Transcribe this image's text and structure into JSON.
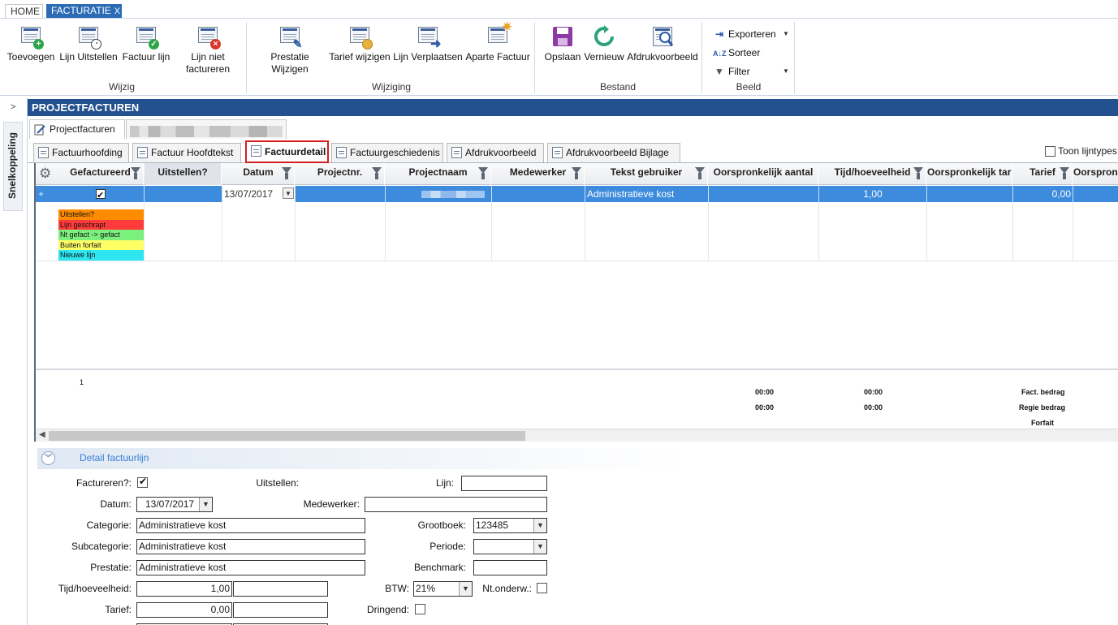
{
  "top_tabs": {
    "home": "HOME",
    "facturatie": "FACTURATIE",
    "close": "X"
  },
  "ribbon": {
    "wijzig": {
      "label": "Wijzig",
      "buttons": [
        "Toevoegen",
        "Lijn Uitstellen",
        "Factuur lijn",
        "Lijn niet",
        "factureren"
      ]
    },
    "wijziging": {
      "label": "Wijziging",
      "buttons": [
        "Prestatie",
        "Wijzigen",
        "Tarief wijzigen",
        "Lijn Verplaatsen",
        "Aparte Factuur"
      ]
    },
    "bestand": {
      "label": "Bestand",
      "buttons": [
        "Opslaan",
        "Vernieuw",
        "Afdrukvoorbeeld"
      ]
    },
    "beeld": {
      "label": "Beeld",
      "buttons": [
        "Exporteren",
        "Sorteer",
        "Filter"
      ]
    }
  },
  "side": {
    "toggle": ">",
    "label": "Snelkoppeling"
  },
  "title": "PROJECTFACTUREN",
  "doc_tabs": {
    "projectfacturen": "Projectfacturen"
  },
  "sub_tabs": [
    "Factuurhoofding",
    "Factuur Hoofdtekst",
    "Factuurdetail",
    "Factuurgeschiedenis",
    "Afdrukvoorbeeld",
    "Afdrukvoorbeeld Bijlage"
  ],
  "toon_lijntypes": "Toon lijntypes",
  "grid": {
    "columns": [
      "Gefactureerd",
      "Uitstellen?",
      "Datum",
      "Projectnr.",
      "Projectnaam",
      "Medewerker",
      "Tekst gebruiker",
      "Oorspronkelijk aantal",
      "Tijd/hoeveelheid",
      "Oorspronkelijk tarief",
      "Tarief",
      "Oorspronk"
    ],
    "row": {
      "datum": "13/07/2017",
      "tekst_gebruiker": "Administratieve kost",
      "tijd": "1,00",
      "tarief": "0,00"
    },
    "legend": [
      {
        "label": "Uitstellen?",
        "color": "#ff8c00"
      },
      {
        "label": "Lijn geschrapt",
        "color": "#ff3b3b"
      },
      {
        "label": "Nt gefact -> gefact",
        "color": "#7cf07c"
      },
      {
        "label": "Buiten forfait",
        "color": "#ffff66"
      },
      {
        "label": "Nieuwe lijn",
        "color": "#2ee6f0"
      }
    ],
    "footer": {
      "count": "1",
      "t1": "00:00",
      "t2": "00:00",
      "t3": "00:00",
      "t4": "00:00",
      "fact_bedrag": "Fact. bedrag",
      "regie_bedrag": "Regie bedrag",
      "forfait": "Forfait"
    }
  },
  "detail": {
    "title": "Detail factuurlijn",
    "labels": {
      "factureren": "Factureren?:",
      "uitstellen": "Uitstellen:",
      "lijn": "Lijn:",
      "datum": "Datum:",
      "medewerker": "Medewerker:",
      "categorie": "Categorie:",
      "grootboek": "Grootboek:",
      "subcategorie": "Subcategorie:",
      "periode": "Periode:",
      "prestatie": "Prestatie:",
      "benchmark": "Benchmark:",
      "tijd": "Tijd/hoeveelheid:",
      "btw": "BTW:",
      "nt_onderw": "Nt.onderw.:",
      "tarief": "Tarief:",
      "dringend": "Dringend:"
    },
    "values": {
      "datum": "13/07/2017",
      "categorie": "Administratieve kost",
      "subcategorie": "Administratieve kost",
      "prestatie": "Administratieve kost",
      "grootboek": "123485",
      "tijd": "1,00",
      "btw": "21%",
      "tarief": "0,00"
    }
  },
  "colors": {
    "accent": "#2b6cb5",
    "title_bar": "#23508f",
    "selected_row": "#3d8bdc",
    "active_tab_border": "#d21f1f"
  }
}
